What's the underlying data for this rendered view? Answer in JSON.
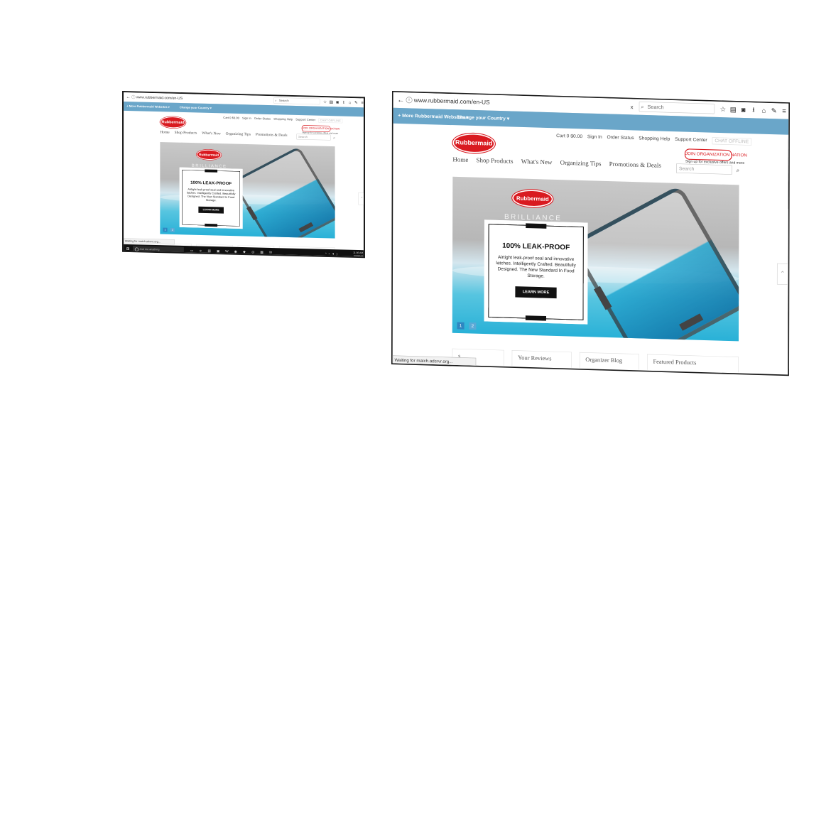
{
  "browser": {
    "url": "www.rubbermaid.com/en-US",
    "search_placeholder": "Search",
    "clear_glyph": "x",
    "icons": [
      "star-icon",
      "clipboard-icon",
      "pocket-icon",
      "download-icon",
      "home-icon",
      "extension-icon",
      "menu-icon"
    ]
  },
  "site_strip": {
    "more_websites": "+ More Rubbermaid Websites  ▾",
    "change_country": "Change your Country  ▾"
  },
  "utility": {
    "cart": "Cart 0  $0.00",
    "sign_in": "Sign In",
    "order_status": "Order Status",
    "shopping_help": "Shopping Help",
    "support_center": "Support Center",
    "chat": "CHAT OFFLINE"
  },
  "logo_text": "Rubbermaid",
  "org_nation": {
    "label": "JOIN ORGANIZATION NATION",
    "sub": "Sign up for exclusive offers and more"
  },
  "nav": {
    "items": [
      "Home",
      "Shop Products",
      "What's New",
      "Organizing Tips",
      "Promotions & Deals"
    ],
    "search_placeholder": "Search"
  },
  "hero": {
    "brand": "Rubbermaid",
    "product": "BRILLIANCE",
    "headline": "100% LEAK-PROOF",
    "body": "Airtight leak-proof seal and innovative latches. Intelligently Crafted. Beautifully Designed. The New Standard In Food Storage.",
    "cta": "LEARN MORE",
    "slides": [
      "1",
      "2"
    ]
  },
  "bottom_tabs": [
    "s",
    "Your Reviews",
    "Organizer Blog",
    "Featured Products"
  ],
  "status_text": "Waiting for match.adsrvr.org...",
  "taskbar": {
    "search": "Ask me anything",
    "time": "11:36 AM",
    "date": "5/3/2017"
  }
}
